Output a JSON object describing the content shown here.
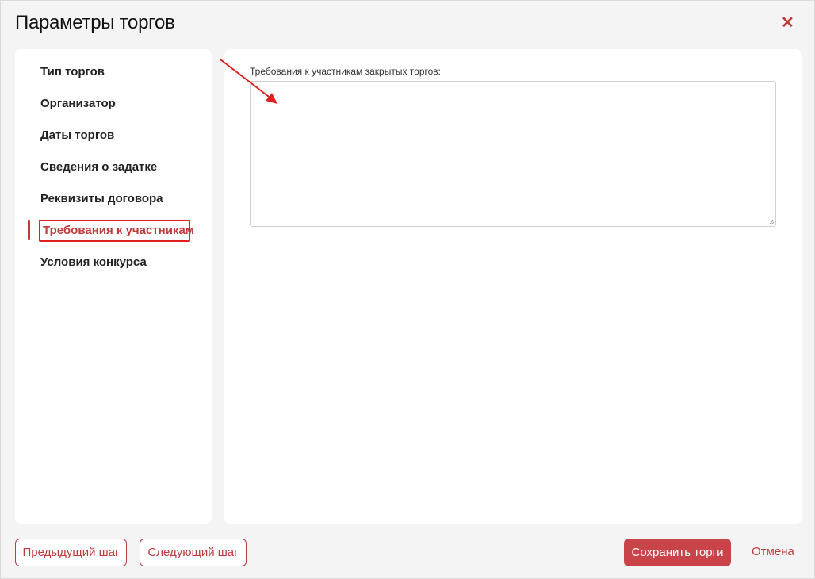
{
  "dialog": {
    "title": "Параметры торгов",
    "close_icon": "close-icon",
    "accent_color": "#c0393b"
  },
  "sidebar": {
    "items": [
      {
        "label": "Тип торгов"
      },
      {
        "label": "Организатор"
      },
      {
        "label": "Даты торгов"
      },
      {
        "label": "Сведения о задатке"
      },
      {
        "label": "Реквизиты договора"
      },
      {
        "label": "Требования к участникам",
        "active": true
      },
      {
        "label": "Условия конкурса"
      }
    ]
  },
  "main": {
    "field_label": "Требования к участникам закрытых торгов:",
    "field_value": ""
  },
  "footer": {
    "prev_label": "Предыдущий шаг",
    "next_label": "Следующий шаг",
    "save_label": "Сохранить торги",
    "cancel_label": "Отмена"
  },
  "annotation": {
    "highlight_color": "#e02020",
    "arrow_icon": "annotation-arrow-icon"
  }
}
